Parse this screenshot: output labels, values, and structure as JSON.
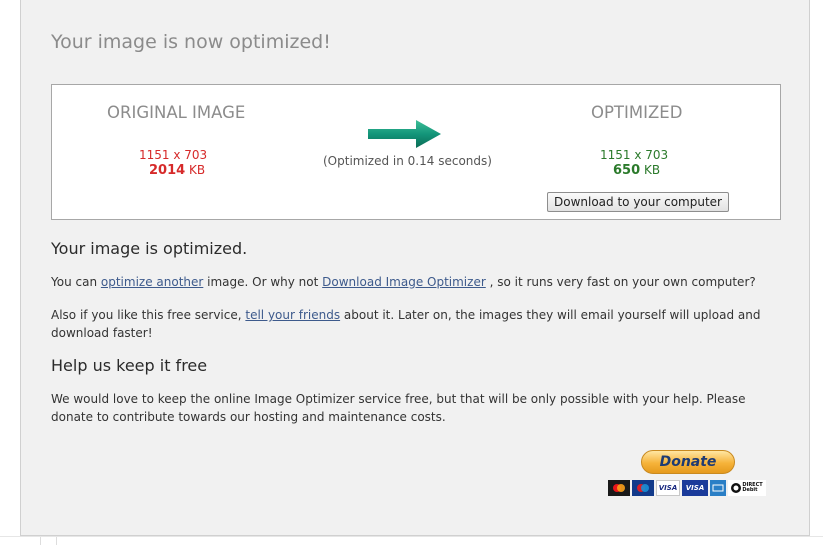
{
  "page": {
    "title": "Your image is now optimized!"
  },
  "result": {
    "original": {
      "heading": "ORIGINAL IMAGE",
      "dimensions": "1151 x 703",
      "size_value": "2014",
      "size_unit": "KB"
    },
    "optimized": {
      "heading": "OPTIMIZED",
      "dimensions": "1151 x 703",
      "size_value": "650",
      "size_unit": "KB"
    },
    "elapsed": "(Optimized in 0.14 seconds)",
    "download_label": "Download to your computer"
  },
  "section1": {
    "heading": "Your image is optimized.",
    "p1_before": "You can ",
    "p1_link1": "optimize another",
    "p1_middle": " image. Or why not ",
    "p1_link2": "Download Image Optimizer",
    "p1_after": " , so it runs very fast on your own computer?",
    "p2_before": "Also if you like this free service, ",
    "p2_link": "tell your friends",
    "p2_after": " about it. Later on, the images they will email yourself will upload and download faster!"
  },
  "section2": {
    "heading": "Help us keep it free",
    "p3": "We would love to keep the online Image Optimizer service free, but that will be only possible with your help. Please donate to contribute towards our hosting and maintenance costs."
  },
  "donate": {
    "label": "Donate",
    "cards": [
      "mastercard-icon",
      "maestro-icon",
      "visa-icon",
      "visa-electron-icon",
      "amex-icon",
      "direct-debit-icon"
    ]
  },
  "colors": {
    "original_red": "#d62a2a",
    "optimized_green": "#2b7a2b",
    "arrow_teal": "#13957a",
    "link_blue": "#3d5a8c"
  }
}
